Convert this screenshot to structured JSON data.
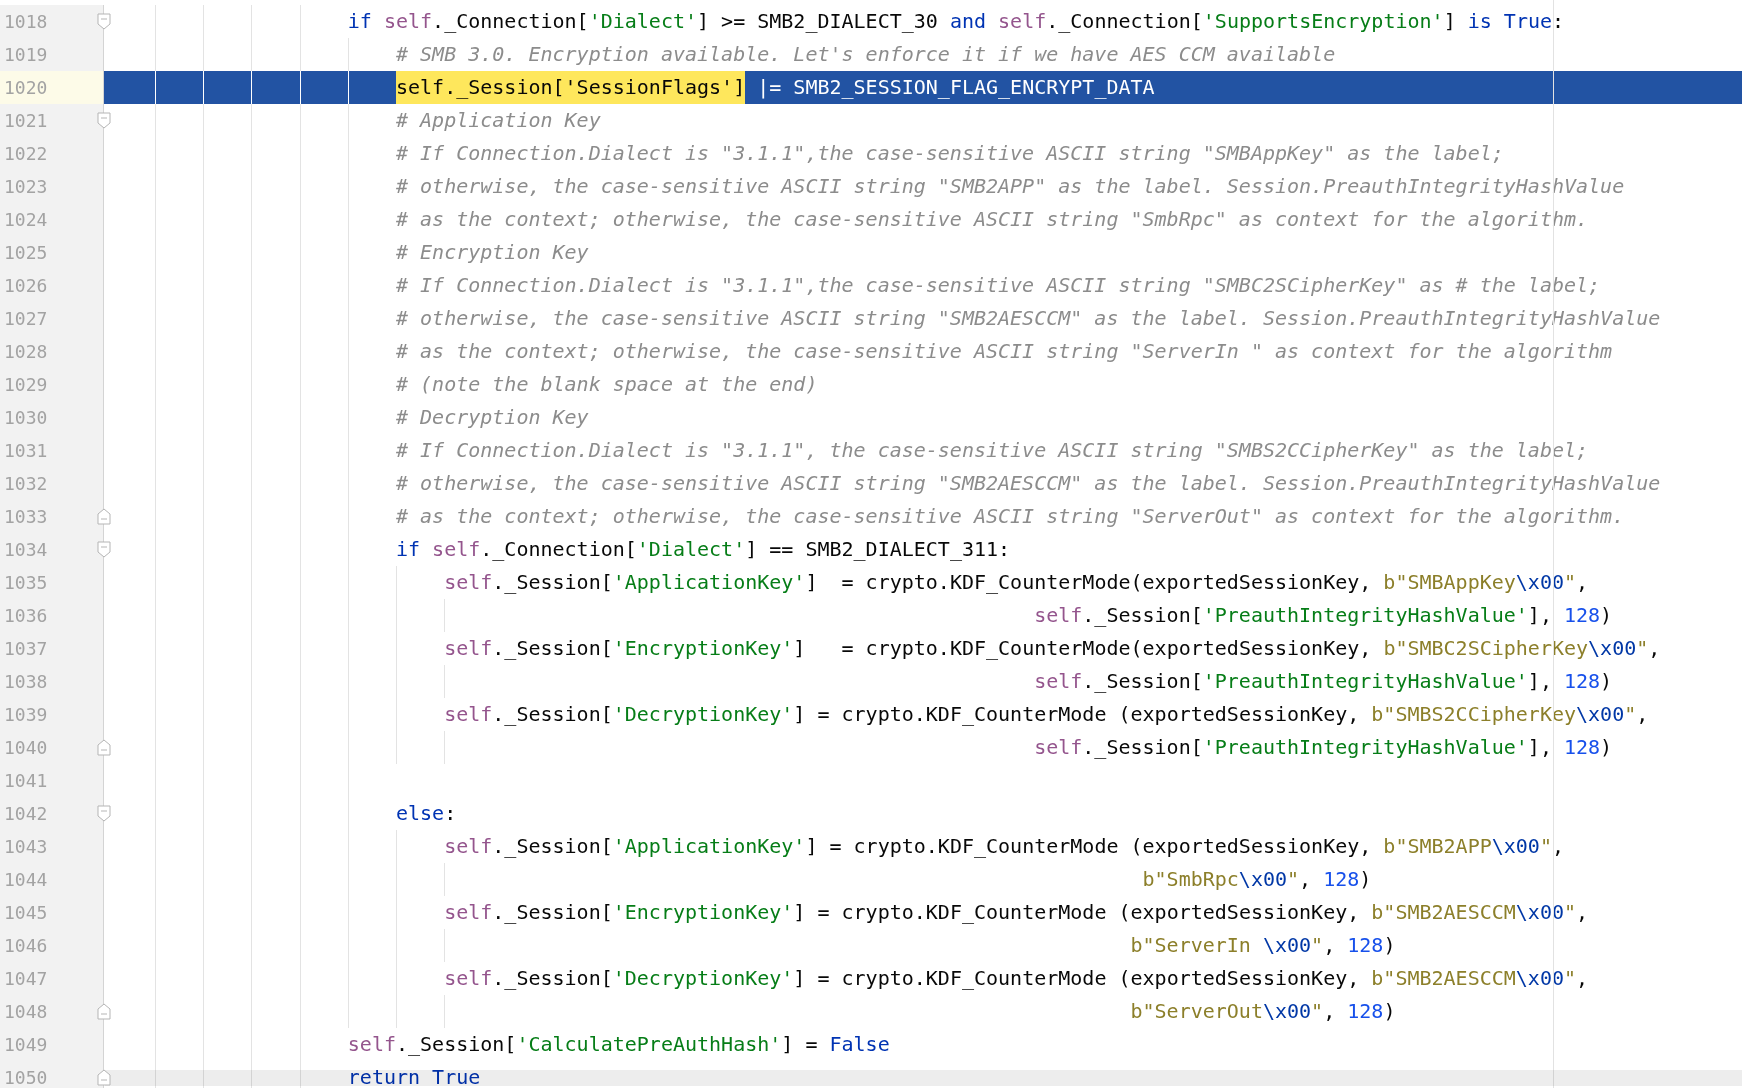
{
  "editor": {
    "lines": [
      {
        "number": "1018",
        "kind": "code",
        "selected": false,
        "fold": {
          "kind": "start"
        },
        "tokens": [
          {
            "kind": "kw",
            "text": "                    if "
          },
          {
            "kind": "self",
            "text": "self"
          },
          {
            "kind": "plain",
            "text": "._Connection["
          },
          {
            "kind": "str",
            "text": "'Dialect'"
          },
          {
            "kind": "plain",
            "text": "] >= SMB2_DIALECT_30 "
          },
          {
            "kind": "kw",
            "text": "and "
          },
          {
            "kind": "self",
            "text": "self"
          },
          {
            "kind": "plain",
            "text": "._Connection["
          },
          {
            "kind": "str",
            "text": "'SupportsEncryption'"
          },
          {
            "kind": "plain",
            "text": "] "
          },
          {
            "kind": "kw",
            "text": "is True"
          },
          {
            "kind": "plain",
            "text": ":"
          }
        ]
      },
      {
        "number": "1019",
        "kind": "code",
        "selected": false,
        "tokens": [
          {
            "kind": "comment",
            "text": "                        # SMB 3.0. Encryption available. Let's enforce it if we have AES CCM available"
          }
        ]
      },
      {
        "number": "1020",
        "kind": "code",
        "selected": true,
        "tokens": [
          {
            "kind": "match",
            "text": "                        self._Session['SessionFlags']"
          },
          {
            "kind": "plain",
            "text": " |= SMB2_SESSION_FLAG_ENCRYPT_DATA"
          }
        ]
      },
      {
        "number": "1021",
        "kind": "code",
        "selected": false,
        "fold": {
          "kind": "start"
        },
        "tokens": [
          {
            "kind": "comment",
            "text": "                        # Application Key"
          }
        ]
      },
      {
        "number": "1022",
        "kind": "code",
        "selected": false,
        "tokens": [
          {
            "kind": "comment",
            "text": "                        # If Connection.Dialect is \"3.1.1\",the case-sensitive ASCII string \"SMBAppKey\" as the label;"
          }
        ]
      },
      {
        "number": "1023",
        "kind": "code",
        "selected": false,
        "tokens": [
          {
            "kind": "comment",
            "text": "                        # otherwise, the case-sensitive ASCII string \"SMB2APP\" as the label. Session.PreauthIntegrityHashValue"
          }
        ]
      },
      {
        "number": "1024",
        "kind": "code",
        "selected": false,
        "tokens": [
          {
            "kind": "comment",
            "text": "                        # as the context; otherwise, the case-sensitive ASCII string \"SmbRpc\" as context for the algorithm."
          }
        ]
      },
      {
        "number": "1025",
        "kind": "code",
        "selected": false,
        "tokens": [
          {
            "kind": "comment",
            "text": "                        # Encryption Key"
          }
        ]
      },
      {
        "number": "1026",
        "kind": "code",
        "selected": false,
        "tokens": [
          {
            "kind": "comment",
            "text": "                        # If Connection.Dialect is \"3.1.1\",the case-sensitive ASCII string \"SMBC2SCipherKey\" as # the label;"
          }
        ]
      },
      {
        "number": "1027",
        "kind": "code",
        "selected": false,
        "tokens": [
          {
            "kind": "comment",
            "text": "                        # otherwise, the case-sensitive ASCII string \"SMB2AESCCM\" as the label. Session.PreauthIntegrityHashValue"
          }
        ]
      },
      {
        "number": "1028",
        "kind": "code",
        "selected": false,
        "tokens": [
          {
            "kind": "comment",
            "text": "                        # as the context; otherwise, the case-sensitive ASCII string \"ServerIn \" as context for the algorithm"
          }
        ]
      },
      {
        "number": "1029",
        "kind": "code",
        "selected": false,
        "tokens": [
          {
            "kind": "comment",
            "text": "                        # (note the blank space at the end)"
          }
        ]
      },
      {
        "number": "1030",
        "kind": "code",
        "selected": false,
        "tokens": [
          {
            "kind": "comment",
            "text": "                        # Decryption Key"
          }
        ]
      },
      {
        "number": "1031",
        "kind": "code",
        "selected": false,
        "tokens": [
          {
            "kind": "comment",
            "text": "                        # If Connection.Dialect is \"3.1.1\", the case-sensitive ASCII string \"SMBS2CCipherKey\" as the label;"
          }
        ]
      },
      {
        "number": "1032",
        "kind": "code",
        "selected": false,
        "tokens": [
          {
            "kind": "comment",
            "text": "                        # otherwise, the case-sensitive ASCII string \"SMB2AESCCM\" as the label. Session.PreauthIntegrityHashValue"
          }
        ]
      },
      {
        "number": "1033",
        "kind": "code",
        "selected": false,
        "fold": {
          "kind": "end"
        },
        "tokens": [
          {
            "kind": "comment",
            "text": "                        # as the context; otherwise, the case-sensitive ASCII string \"ServerOut\" as context for the algorithm."
          }
        ]
      },
      {
        "number": "1034",
        "kind": "code",
        "selected": false,
        "fold": {
          "kind": "start"
        },
        "tokens": [
          {
            "kind": "kw",
            "text": "                        if "
          },
          {
            "kind": "self",
            "text": "self"
          },
          {
            "kind": "plain",
            "text": "._Connection["
          },
          {
            "kind": "str",
            "text": "'Dialect'"
          },
          {
            "kind": "plain",
            "text": "] == SMB2_DIALECT_311:"
          }
        ]
      },
      {
        "number": "1035",
        "kind": "code",
        "selected": false,
        "tokens": [
          {
            "kind": "self",
            "text": "                            self"
          },
          {
            "kind": "plain",
            "text": "._Session["
          },
          {
            "kind": "str",
            "text": "'ApplicationKey'"
          },
          {
            "kind": "plain",
            "text": "]  = crypto.KDF_CounterMode(exportedSessionKey, "
          },
          {
            "kind": "bytes",
            "text": "b\"SMBAppKey"
          },
          {
            "kind": "esc",
            "text": "\\x00"
          },
          {
            "kind": "bytes",
            "text": "\""
          },
          {
            "kind": "plain",
            "text": ","
          }
        ]
      },
      {
        "number": "1036",
        "kind": "continuation",
        "selected": false,
        "tokens": [
          {
            "kind": "self",
            "text": "                                                                             self"
          },
          {
            "kind": "plain",
            "text": "._Session["
          },
          {
            "kind": "str",
            "text": "'PreauthIntegrityHashValue'"
          },
          {
            "kind": "plain",
            "text": "], "
          },
          {
            "kind": "num",
            "text": "128"
          },
          {
            "kind": "plain",
            "text": ")"
          }
        ]
      },
      {
        "number": "1037",
        "kind": "code",
        "selected": false,
        "tokens": [
          {
            "kind": "self",
            "text": "                            self"
          },
          {
            "kind": "plain",
            "text": "._Session["
          },
          {
            "kind": "str",
            "text": "'EncryptionKey'"
          },
          {
            "kind": "plain",
            "text": "]   = crypto.KDF_CounterMode(exportedSessionKey, "
          },
          {
            "kind": "bytes",
            "text": "b\"SMBC2SCipherKey"
          },
          {
            "kind": "esc",
            "text": "\\x00"
          },
          {
            "kind": "bytes",
            "text": "\""
          },
          {
            "kind": "plain",
            "text": ","
          }
        ]
      },
      {
        "number": "1038",
        "kind": "continuation",
        "selected": false,
        "tokens": [
          {
            "kind": "self",
            "text": "                                                                             self"
          },
          {
            "kind": "plain",
            "text": "._Session["
          },
          {
            "kind": "str",
            "text": "'PreauthIntegrityHashValue'"
          },
          {
            "kind": "plain",
            "text": "], "
          },
          {
            "kind": "num",
            "text": "128"
          },
          {
            "kind": "plain",
            "text": ")"
          }
        ]
      },
      {
        "number": "1039",
        "kind": "code",
        "selected": false,
        "tokens": [
          {
            "kind": "self",
            "text": "                            self"
          },
          {
            "kind": "plain",
            "text": "._Session["
          },
          {
            "kind": "str",
            "text": "'DecryptionKey'"
          },
          {
            "kind": "plain",
            "text": "] = crypto.KDF_CounterMode (exportedSessionKey, "
          },
          {
            "kind": "bytes",
            "text": "b\"SMBS2CCipherKey"
          },
          {
            "kind": "esc",
            "text": "\\x00"
          },
          {
            "kind": "bytes",
            "text": "\""
          },
          {
            "kind": "plain",
            "text": ","
          }
        ]
      },
      {
        "number": "1040",
        "kind": "continuation",
        "selected": false,
        "fold": {
          "kind": "end"
        },
        "tokens": [
          {
            "kind": "self",
            "text": "                                                                             self"
          },
          {
            "kind": "plain",
            "text": "._Session["
          },
          {
            "kind": "str",
            "text": "'PreauthIntegrityHashValue'"
          },
          {
            "kind": "plain",
            "text": "], "
          },
          {
            "kind": "num",
            "text": "128"
          },
          {
            "kind": "plain",
            "text": ")"
          }
        ]
      },
      {
        "number": "1041",
        "kind": "blank",
        "selected": false
      },
      {
        "number": "1042",
        "kind": "code",
        "selected": false,
        "fold": {
          "kind": "start"
        },
        "tokens": [
          {
            "kind": "kw",
            "text": "                        else"
          },
          {
            "kind": "plain",
            "text": ":"
          }
        ]
      },
      {
        "number": "1043",
        "kind": "code",
        "selected": false,
        "tokens": [
          {
            "kind": "self",
            "text": "                            self"
          },
          {
            "kind": "plain",
            "text": "._Session["
          },
          {
            "kind": "str",
            "text": "'ApplicationKey'"
          },
          {
            "kind": "plain",
            "text": "] = crypto.KDF_CounterMode (exportedSessionKey, "
          },
          {
            "kind": "bytes",
            "text": "b\"SMB2APP"
          },
          {
            "kind": "esc",
            "text": "\\x00"
          },
          {
            "kind": "bytes",
            "text": "\""
          },
          {
            "kind": "plain",
            "text": ","
          }
        ]
      },
      {
        "number": "1044",
        "kind": "continuation",
        "selected": false,
        "tokens": [
          {
            "kind": "bytes",
            "text": "                                                                                      b\"SmbRpc"
          },
          {
            "kind": "esc",
            "text": "\\x00"
          },
          {
            "kind": "bytes",
            "text": "\""
          },
          {
            "kind": "plain",
            "text": ", "
          },
          {
            "kind": "num",
            "text": "128"
          },
          {
            "kind": "plain",
            "text": ")"
          }
        ]
      },
      {
        "number": "1045",
        "kind": "code",
        "selected": false,
        "tokens": [
          {
            "kind": "self",
            "text": "                            self"
          },
          {
            "kind": "plain",
            "text": "._Session["
          },
          {
            "kind": "str",
            "text": "'EncryptionKey'"
          },
          {
            "kind": "plain",
            "text": "] = crypto.KDF_CounterMode (exportedSessionKey, "
          },
          {
            "kind": "bytes",
            "text": "b\"SMB2AESCCM"
          },
          {
            "kind": "esc",
            "text": "\\x00"
          },
          {
            "kind": "bytes",
            "text": "\""
          },
          {
            "kind": "plain",
            "text": ","
          }
        ]
      },
      {
        "number": "1046",
        "kind": "continuation",
        "selected": false,
        "tokens": [
          {
            "kind": "bytes",
            "text": "                                                                                     b\"ServerIn "
          },
          {
            "kind": "esc",
            "text": "\\x00"
          },
          {
            "kind": "bytes",
            "text": "\""
          },
          {
            "kind": "plain",
            "text": ", "
          },
          {
            "kind": "num",
            "text": "128"
          },
          {
            "kind": "plain",
            "text": ")"
          }
        ]
      },
      {
        "number": "1047",
        "kind": "code",
        "selected": false,
        "tokens": [
          {
            "kind": "self",
            "text": "                            self"
          },
          {
            "kind": "plain",
            "text": "._Session["
          },
          {
            "kind": "str",
            "text": "'DecryptionKey'"
          },
          {
            "kind": "plain",
            "text": "] = crypto.KDF_CounterMode (exportedSessionKey, "
          },
          {
            "kind": "bytes",
            "text": "b\"SMB2AESCCM"
          },
          {
            "kind": "esc",
            "text": "\\x00"
          },
          {
            "kind": "bytes",
            "text": "\""
          },
          {
            "kind": "plain",
            "text": ","
          }
        ]
      },
      {
        "number": "1048",
        "kind": "continuation",
        "selected": false,
        "fold": {
          "kind": "end"
        },
        "tokens": [
          {
            "kind": "bytes",
            "text": "                                                                                     b\"ServerOut"
          },
          {
            "kind": "esc",
            "text": "\\x00"
          },
          {
            "kind": "bytes",
            "text": "\""
          },
          {
            "kind": "plain",
            "text": ", "
          },
          {
            "kind": "num",
            "text": "128"
          },
          {
            "kind": "plain",
            "text": ")"
          }
        ]
      },
      {
        "number": "1049",
        "kind": "code",
        "selected": false,
        "tokens": [
          {
            "kind": "self",
            "text": "                    self"
          },
          {
            "kind": "plain",
            "text": "._Session["
          },
          {
            "kind": "str",
            "text": "'CalculatePreAuthHash'"
          },
          {
            "kind": "plain",
            "text": "] = "
          },
          {
            "kind": "kw",
            "text": "False"
          }
        ]
      },
      {
        "number": "1050",
        "kind": "code",
        "selected": false,
        "fold": {
          "kind": "end"
        },
        "tokens": [
          {
            "kind": "kw",
            "text": "                    return True"
          }
        ]
      }
    ]
  }
}
